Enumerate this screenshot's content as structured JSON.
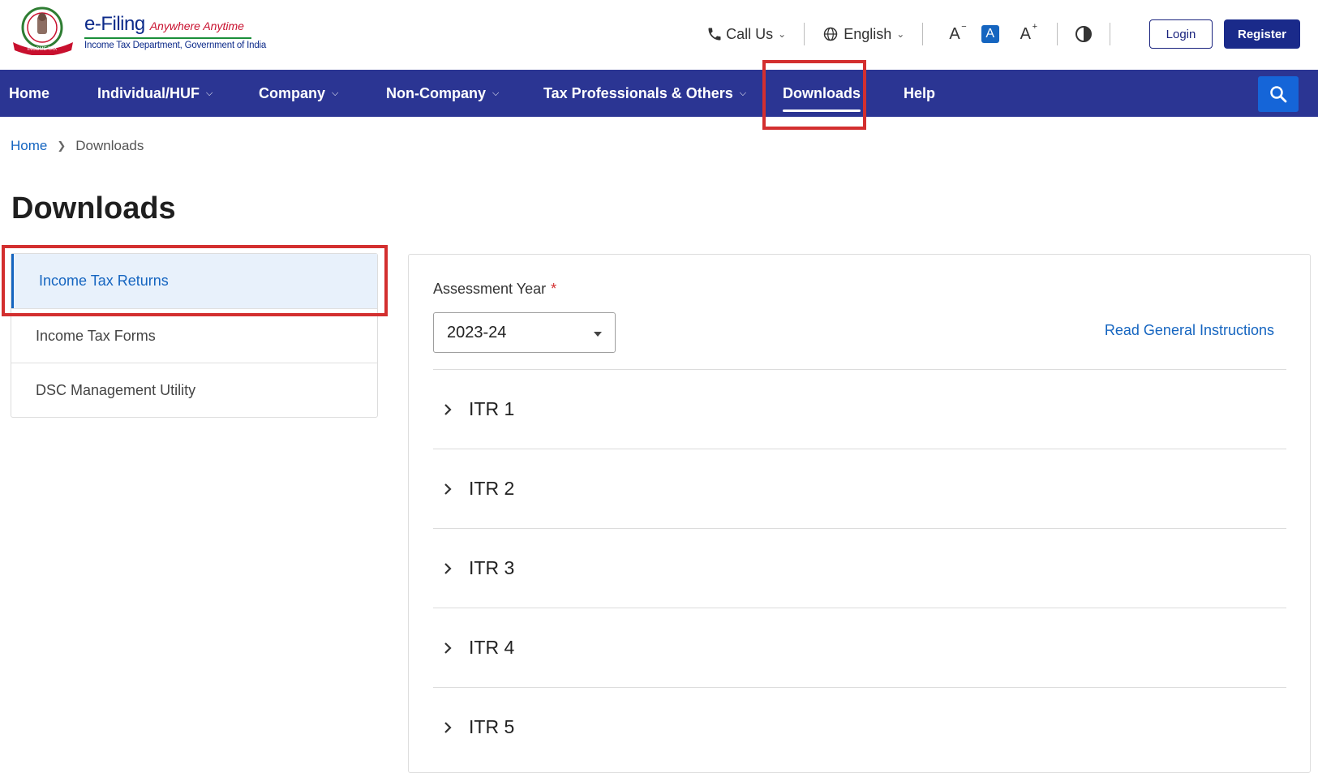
{
  "header": {
    "brand_name": "e-Filing",
    "brand_tagline": "Anywhere Anytime",
    "brand_subtitle": "Income Tax Department, Government of India",
    "call_us": "Call Us",
    "language": "English",
    "font_decrease": "A",
    "font_normal": "A",
    "font_increase": "A",
    "login_label": "Login",
    "register_label": "Register"
  },
  "nav": {
    "items": [
      {
        "label": "Home"
      },
      {
        "label": "Individual/HUF"
      },
      {
        "label": "Company"
      },
      {
        "label": "Non-Company"
      },
      {
        "label": "Tax Professionals & Others"
      },
      {
        "label": "Downloads"
      },
      {
        "label": "Help"
      }
    ],
    "active": "Downloads"
  },
  "breadcrumb": {
    "home": "Home",
    "current": "Downloads"
  },
  "page": {
    "title": "Downloads"
  },
  "sidebar": {
    "items": [
      {
        "label": "Income Tax Returns",
        "active": true
      },
      {
        "label": "Income Tax Forms"
      },
      {
        "label": "DSC Management Utility"
      }
    ]
  },
  "main": {
    "assessment_year_label": "Assessment Year",
    "required_marker": "*",
    "assessment_year_value": "2023-24",
    "read_instructions": "Read General Instructions",
    "itr_items": [
      {
        "label": "ITR 1"
      },
      {
        "label": "ITR 2"
      },
      {
        "label": "ITR 3"
      },
      {
        "label": "ITR 4"
      },
      {
        "label": "ITR 5"
      }
    ]
  },
  "colors": {
    "nav_bg": "#2b3593",
    "accent": "#1565c0",
    "highlight": "#d32f2f"
  }
}
